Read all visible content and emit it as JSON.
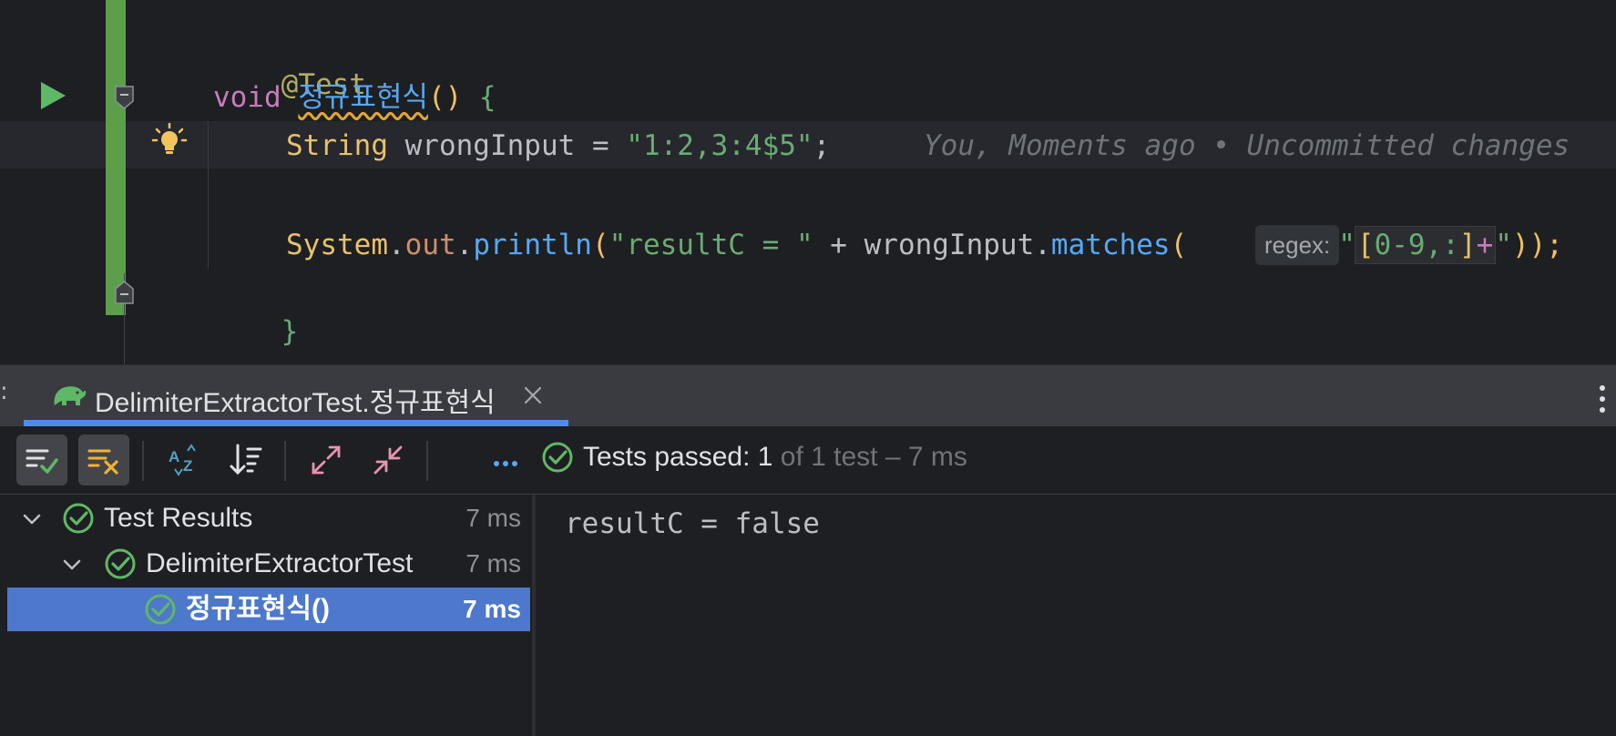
{
  "editor": {
    "line1": {
      "annotation": "@Test"
    },
    "line2": {
      "kw": "void",
      "method": "정규표현식",
      "parens": "()",
      "brace": " {"
    },
    "line3": {
      "type": "String",
      "var": " wrongInput = ",
      "value": "\"1:2,3:4$5\"",
      "semi": ";"
    },
    "line4": {
      "system": "System",
      "dot1": ".",
      "out": "out",
      "dot2": ".",
      "println": "println",
      "open": "(",
      "str": "\"resultC = \"",
      "plus": " + wrongInput.",
      "matches": "matches",
      "open2": "(",
      "hint": "regex:",
      "q1": "\"",
      "rx_open": "[",
      "rx_num": "0-9",
      "rx_sep": ",:",
      "rx_close": "]",
      "rx_plus": "+",
      "q2": "\"",
      "close": "));"
    },
    "line5": {
      "brace": "}"
    },
    "blame": "You, Moments ago • Uncommitted changes"
  },
  "tool_window": {
    "left_colon": ":",
    "tab_label": "DelimiterExtractorTest.정규표현식"
  },
  "toolbar": {
    "status_main": "Tests passed: 1",
    "status_rest": " of 1 test – 7 ms"
  },
  "tree": {
    "rows": [
      {
        "label": "Test Results",
        "time": "7 ms"
      },
      {
        "label": "DelimiterExtractorTest",
        "time": "7 ms"
      },
      {
        "label": "정규표현식()",
        "time": "7 ms"
      }
    ]
  },
  "console": {
    "output": "resultC = false"
  },
  "colors": {
    "accent": "#4f8be6",
    "selection": "#4d78cc",
    "success": "#5fb865",
    "vcs_added": "#5d9e4b"
  }
}
